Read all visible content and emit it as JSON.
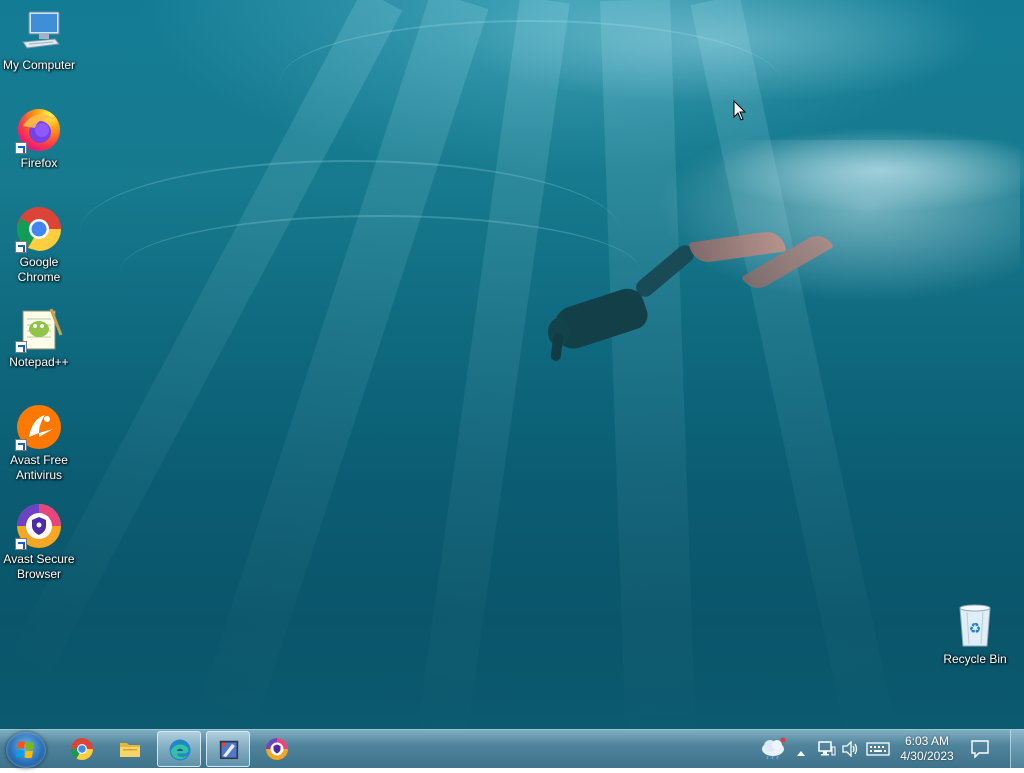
{
  "desktop": {
    "icons": [
      {
        "label": "My Computer",
        "icon": "computer-icon"
      },
      {
        "label": "Firefox",
        "icon": "firefox-icon"
      },
      {
        "label": "Google Chrome",
        "icon": "chrome-icon"
      },
      {
        "label": "Notepad++",
        "icon": "notepadpp-icon"
      },
      {
        "label": "Avast Free Antivirus",
        "icon": "avast-antivirus-icon"
      },
      {
        "label": "Avast Secure Browser",
        "icon": "avast-browser-icon"
      },
      {
        "label": "Recycle Bin",
        "icon": "recycle-bin-icon"
      }
    ]
  },
  "taskbar": {
    "start": {
      "icon": "windows-start-icon"
    },
    "pinned": [
      {
        "name": "Google Chrome",
        "icon": "chrome-icon",
        "active": false
      },
      {
        "name": "File Explorer",
        "icon": "folder-icon",
        "active": false
      },
      {
        "name": "Microsoft Edge",
        "icon": "edge-icon",
        "active": true
      },
      {
        "name": "App",
        "icon": "app-window-icon",
        "active": true
      },
      {
        "name": "Avast Secure Browser",
        "icon": "avast-browser-icon",
        "active": false
      }
    ],
    "tray": {
      "icons": [
        "weather-icon",
        "show-hidden-icons-chevron",
        "network-icon",
        "volume-icon",
        "keyboard-icon",
        "notification-icon"
      ]
    },
    "clock": {
      "time": "6:03 AM",
      "date": "4/30/2023"
    }
  },
  "colors": {
    "water_top": "#137c95",
    "water_bottom": "#0b5a6f",
    "taskbar": "#467d96",
    "text": "#ffffff"
  }
}
